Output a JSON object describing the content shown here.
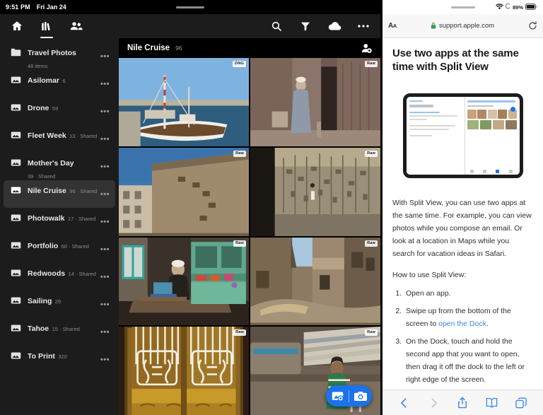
{
  "photos_app": {
    "status_bar": {
      "time": "9:51 PM",
      "date": "Fri Jan 24"
    },
    "nav_icons": [
      {
        "name": "home-icon",
        "label": "Home"
      },
      {
        "name": "library-icon",
        "label": "Library"
      },
      {
        "name": "sharing-icon",
        "label": "Sharing"
      }
    ],
    "toolbar_icons": [
      {
        "name": "search-icon",
        "label": "Search"
      },
      {
        "name": "filter-icon",
        "label": "Filter"
      },
      {
        "name": "cloud-icon",
        "label": "Cloud backup"
      },
      {
        "name": "more-icon",
        "label": "More options"
      }
    ],
    "header": {
      "title": "Nile Cruise",
      "count": "96",
      "add_person_label": "Add person"
    },
    "albums": [
      {
        "name": "Travel Photos",
        "meta": "48 items",
        "icon": "folder-icon",
        "selected": false
      },
      {
        "name": "Asilomar",
        "meta": "6",
        "icon": "album-icon",
        "selected": false
      },
      {
        "name": "Drone",
        "meta": "59",
        "icon": "album-icon",
        "selected": false
      },
      {
        "name": "Fleet Week",
        "meta": "13 · Shared",
        "icon": "album-icon",
        "selected": false
      },
      {
        "name": "Mother's Day",
        "meta": "39 · Shared",
        "icon": "album-icon",
        "selected": false
      },
      {
        "name": "Nile Cruise",
        "meta": "96 · Shared",
        "icon": "album-icon",
        "selected": true
      },
      {
        "name": "Photowalk",
        "meta": "17 · Shared",
        "icon": "album-icon",
        "selected": false
      },
      {
        "name": "Portfolio",
        "meta": "60 · Shared",
        "icon": "album-icon",
        "selected": false
      },
      {
        "name": "Redwoods",
        "meta": "14 · Shared",
        "icon": "album-icon",
        "selected": false
      },
      {
        "name": "Sailing",
        "meta": "29",
        "icon": "album-icon",
        "selected": false
      },
      {
        "name": "Tahoe",
        "meta": "15 · Shared",
        "icon": "album-icon",
        "selected": false
      },
      {
        "name": "To Print",
        "meta": "320",
        "icon": "album-icon",
        "selected": false
      }
    ],
    "album_more_label": "•••",
    "photos": [
      {
        "alt": "Sailboat moored on the Nile",
        "badge": "DNG"
      },
      {
        "alt": "Man in white cap beside temple pillars",
        "badge": "Raw"
      },
      {
        "alt": "Stone temple wall and building",
        "badge": "Raw"
      },
      {
        "alt": "Carved hieroglyph wall relief",
        "badge": "Raw"
      },
      {
        "alt": "Tailor at sewing machine in workshop",
        "badge": "Raw"
      },
      {
        "alt": "Mud-brick village alleyway",
        "badge": "Raw"
      },
      {
        "alt": "Ornate wooden and iron doors",
        "badge": "Raw"
      },
      {
        "alt": "Boy with goat beside stacked timber",
        "badge": "Raw"
      }
    ],
    "fab": {
      "photo_picker_label": "Add photos",
      "camera_label": "Camera"
    }
  },
  "safari": {
    "status_bar": {
      "battery": "89%",
      "wifi_icon": "wifi-icon",
      "battery_icon": "battery-icon"
    },
    "toolbar": {
      "text_size_label": "AA",
      "lock_icon": "lock-icon",
      "url": "support.apple.com",
      "reload_label": "Reload"
    },
    "article": {
      "title": "Use two apps at the same time with Split View",
      "figure_alt": "iPad showing Mail and Photos side by side in Split View",
      "paragraph": "With Split View, you can use two apps at the same time. For example, you can view photos while you compose an email. Or look at a location in Maps while you search for vacation ideas in Safari.",
      "how_to_heading": "How to use Split View:",
      "steps": [
        {
          "pre": "Open an app.",
          "link": "",
          "post": ""
        },
        {
          "pre": "Swipe up from the bottom of the screen to ",
          "link": "open the Dock",
          "post": "."
        },
        {
          "pre": "On the Dock, touch and hold the second app that you want to open, then drag it off the dock to the left or right edge of the screen.",
          "link": "",
          "post": ""
        }
      ]
    },
    "bottom_bar": [
      {
        "name": "back-icon",
        "label": "Back",
        "disabled": false
      },
      {
        "name": "forward-icon",
        "label": "Forward",
        "disabled": true
      },
      {
        "name": "share-icon",
        "label": "Share",
        "disabled": false
      },
      {
        "name": "bookmarks-icon",
        "label": "Bookmarks",
        "disabled": false
      },
      {
        "name": "tabs-icon",
        "label": "Tabs",
        "disabled": false
      }
    ]
  },
  "colors": {
    "accent_blue": "#1a73e8",
    "link_blue": "#3a86ef",
    "safari_chrome": "#f7f7f7",
    "sidebar_bg": "#1c1c1c",
    "selected_row": "#333333",
    "lock_green": "#2e9e4f"
  }
}
